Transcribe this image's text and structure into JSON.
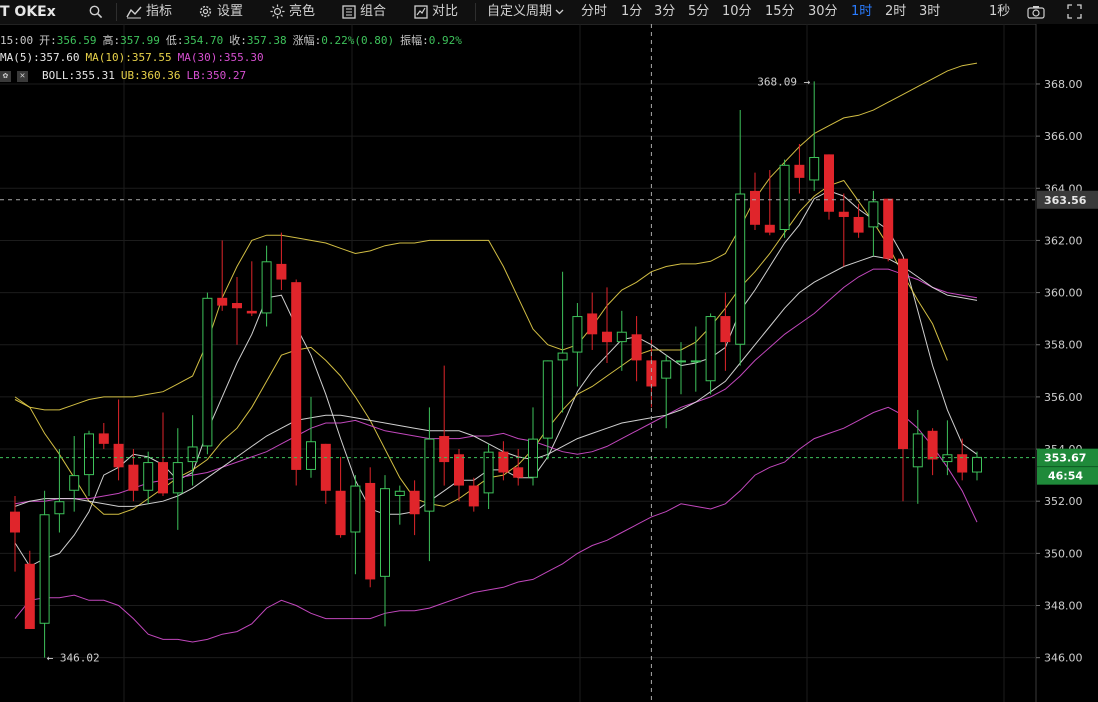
{
  "toolbar": {
    "title": "T OKEx",
    "indicators_label": "指标",
    "settings_label": "设置",
    "brightness_label": "亮色",
    "combine_label": "组合",
    "compare_label": "对比",
    "custom_period_label": "自定义周期",
    "periods": [
      "分时",
      "1分",
      "3分",
      "5分",
      "10分",
      "15分",
      "30分",
      "1时",
      "2时",
      "3时"
    ],
    "active_period": "1时",
    "refresh_label": "1秒"
  },
  "info": {
    "time": "15:00",
    "open_label": "开:",
    "open": "356.59",
    "high_label": "高:",
    "high": "357.99",
    "low_label": "低:",
    "low": "354.70",
    "close_label": "收:",
    "close": "357.38",
    "change_label": "涨幅:",
    "change": "0.22%(0.80)",
    "amp_label": "振幅:",
    "amp": "0.92%",
    "ma5": "MA(5):357.60",
    "ma10": "MA(10):357.55",
    "ma30": "MA(30):355.30",
    "boll": "BOLL:355.31",
    "ub": "UB:360.36",
    "lb": "LB:350.27"
  },
  "price_labels": {
    "crosshair": "363.56",
    "current": "353.67",
    "countdown": "46:54"
  },
  "annotations": {
    "high": "368.09 →",
    "low": "← 346.02"
  },
  "colors": {
    "up": "#3ec25b",
    "down": "#e0252b",
    "ma5": "#e6e6e6",
    "ma10": "#e8d24a",
    "ma30": "#d64fd0",
    "boll": "#e6e6e6",
    "ub": "#e8d24a",
    "lb": "#d64fd0"
  },
  "chart_data": {
    "type": "candlestick",
    "ylim": [
      344.3,
      370.3
    ],
    "y_ticks": [
      "346.00",
      "348.00",
      "350.00",
      "352.00",
      "354.00",
      "356.00",
      "358.00",
      "360.00",
      "362.00",
      "364.00",
      "366.00",
      "368.00"
    ],
    "candles": [
      {
        "o": 351.6,
        "h": 352.2,
        "l": 349.3,
        "c": 350.8
      },
      {
        "o": 349.6,
        "h": 350.1,
        "l": 347.1,
        "c": 347.1
      },
      {
        "o": 347.3,
        "h": 352.4,
        "l": 346.0,
        "c": 351.5
      },
      {
        "o": 351.5,
        "h": 354.0,
        "l": 350.8,
        "c": 352.0
      },
      {
        "o": 352.4,
        "h": 354.5,
        "l": 351.6,
        "c": 353.0
      },
      {
        "o": 353.0,
        "h": 354.7,
        "l": 352.2,
        "c": 354.6
      },
      {
        "o": 354.6,
        "h": 355.0,
        "l": 354.0,
        "c": 354.2
      },
      {
        "o": 354.2,
        "h": 355.9,
        "l": 352.8,
        "c": 353.3
      },
      {
        "o": 353.4,
        "h": 354.0,
        "l": 352.0,
        "c": 352.4
      },
      {
        "o": 352.4,
        "h": 353.9,
        "l": 351.9,
        "c": 353.5
      },
      {
        "o": 353.5,
        "h": 355.4,
        "l": 352.2,
        "c": 352.3
      },
      {
        "o": 352.3,
        "h": 354.8,
        "l": 350.9,
        "c": 353.5
      },
      {
        "o": 353.5,
        "h": 355.3,
        "l": 352.6,
        "c": 354.1
      },
      {
        "o": 354.1,
        "h": 360.0,
        "l": 353.8,
        "c": 359.8
      },
      {
        "o": 359.8,
        "h": 362.0,
        "l": 359.3,
        "c": 359.5
      },
      {
        "o": 359.6,
        "h": 360.6,
        "l": 358.0,
        "c": 359.4
      },
      {
        "o": 359.3,
        "h": 361.2,
        "l": 359.1,
        "c": 359.2
      },
      {
        "o": 359.2,
        "h": 361.8,
        "l": 358.7,
        "c": 361.2
      },
      {
        "o": 361.1,
        "h": 362.3,
        "l": 360.1,
        "c": 360.5
      },
      {
        "o": 360.4,
        "h": 360.5,
        "l": 352.6,
        "c": 353.2
      },
      {
        "o": 353.2,
        "h": 356.0,
        "l": 352.9,
        "c": 354.3
      },
      {
        "o": 354.2,
        "h": 354.2,
        "l": 351.9,
        "c": 352.4
      },
      {
        "o": 352.4,
        "h": 353.7,
        "l": 350.6,
        "c": 350.7
      },
      {
        "o": 350.8,
        "h": 353.0,
        "l": 349.2,
        "c": 352.6
      },
      {
        "o": 352.7,
        "h": 353.3,
        "l": 348.7,
        "c": 349.0
      },
      {
        "o": 349.1,
        "h": 353.0,
        "l": 347.2,
        "c": 352.5
      },
      {
        "o": 352.2,
        "h": 352.6,
        "l": 351.1,
        "c": 352.4
      },
      {
        "o": 352.4,
        "h": 352.8,
        "l": 350.7,
        "c": 351.5
      },
      {
        "o": 351.6,
        "h": 355.6,
        "l": 349.7,
        "c": 354.4
      },
      {
        "o": 354.5,
        "h": 357.2,
        "l": 352.6,
        "c": 353.5
      },
      {
        "o": 353.8,
        "h": 354.0,
        "l": 352.0,
        "c": 352.6
      },
      {
        "o": 352.6,
        "h": 352.9,
        "l": 351.6,
        "c": 351.8
      },
      {
        "o": 352.3,
        "h": 354.2,
        "l": 351.7,
        "c": 353.9
      },
      {
        "o": 353.9,
        "h": 354.3,
        "l": 352.8,
        "c": 353.1
      },
      {
        "o": 353.3,
        "h": 354.0,
        "l": 352.6,
        "c": 352.9
      },
      {
        "o": 352.9,
        "h": 355.6,
        "l": 352.6,
        "c": 354.4
      },
      {
        "o": 354.4,
        "h": 357.4,
        "l": 353.6,
        "c": 357.4
      },
      {
        "o": 357.4,
        "h": 360.8,
        "l": 355.4,
        "c": 357.7
      },
      {
        "o": 357.7,
        "h": 359.6,
        "l": 356.4,
        "c": 359.1
      },
      {
        "o": 359.2,
        "h": 360.0,
        "l": 357.8,
        "c": 358.4
      },
      {
        "o": 358.5,
        "h": 360.2,
        "l": 357.3,
        "c": 358.1
      },
      {
        "o": 358.1,
        "h": 359.3,
        "l": 357.0,
        "c": 358.5
      },
      {
        "o": 358.4,
        "h": 359.1,
        "l": 356.6,
        "c": 357.4
      },
      {
        "o": 357.4,
        "h": 358.2,
        "l": 355.6,
        "c": 356.4
      },
      {
        "o": 356.7,
        "h": 357.6,
        "l": 354.8,
        "c": 357.4
      },
      {
        "o": 357.4,
        "h": 358.1,
        "l": 356.1,
        "c": 357.4
      },
      {
        "o": 357.4,
        "h": 358.7,
        "l": 356.2,
        "c": 357.4
      },
      {
        "o": 356.6,
        "h": 359.2,
        "l": 356.1,
        "c": 359.1
      },
      {
        "o": 359.1,
        "h": 360.0,
        "l": 357.0,
        "c": 358.1
      },
      {
        "o": 358.0,
        "h": 367.0,
        "l": 357.2,
        "c": 363.8
      },
      {
        "o": 363.9,
        "h": 364.6,
        "l": 362.4,
        "c": 362.6
      },
      {
        "o": 362.6,
        "h": 364.7,
        "l": 362.2,
        "c": 362.3
      },
      {
        "o": 362.4,
        "h": 365.1,
        "l": 362.1,
        "c": 364.9
      },
      {
        "o": 364.9,
        "h": 365.7,
        "l": 363.8,
        "c": 364.4
      },
      {
        "o": 364.3,
        "h": 368.1,
        "l": 363.9,
        "c": 365.2
      },
      {
        "o": 365.3,
        "h": 365.3,
        "l": 362.8,
        "c": 363.1
      },
      {
        "o": 363.1,
        "h": 363.8,
        "l": 361.0,
        "c": 362.9
      },
      {
        "o": 362.9,
        "h": 363.4,
        "l": 362.1,
        "c": 362.3
      },
      {
        "o": 362.5,
        "h": 363.9,
        "l": 361.4,
        "c": 363.5
      },
      {
        "o": 363.6,
        "h": 363.6,
        "l": 361.2,
        "c": 361.3
      },
      {
        "o": 361.3,
        "h": 361.3,
        "l": 352.0,
        "c": 354.0
      },
      {
        "o": 353.3,
        "h": 355.5,
        "l": 351.9,
        "c": 354.6
      },
      {
        "o": 354.7,
        "h": 354.8,
        "l": 353.0,
        "c": 353.6
      },
      {
        "o": 353.5,
        "h": 355.1,
        "l": 353.0,
        "c": 353.8
      },
      {
        "o": 353.8,
        "h": 354.4,
        "l": 352.8,
        "c": 353.1
      },
      {
        "o": 353.1,
        "h": 353.9,
        "l": 352.8,
        "c": 353.7
      }
    ],
    "series": [
      {
        "name": "MA(5)",
        "values": [
          350.4,
          349.5,
          349.8,
          350.0,
          350.7,
          351.6,
          353.0,
          353.3,
          353.8,
          353.7,
          353.4,
          352.8,
          353.1,
          354.7,
          356.0,
          357.3,
          358.4,
          359.8,
          359.9,
          358.7,
          357.6,
          356.1,
          354.4,
          352.8,
          351.7,
          351.5,
          351.5,
          351.6,
          352.0,
          352.4,
          352.8,
          352.8,
          353.2,
          353.2,
          352.9,
          352.9,
          353.7,
          354.9,
          356.2,
          357.0,
          357.6,
          358.2,
          358.3,
          358.0,
          357.6,
          357.2,
          357.3,
          357.5,
          357.9,
          359.3,
          360.1,
          361.0,
          361.9,
          362.6,
          363.6,
          363.9,
          363.7,
          363.2,
          362.8,
          362.4,
          361.4,
          359.3,
          357.2,
          355.5,
          354.2,
          353.8
        ]
      },
      {
        "name": "MA(10)",
        "values": [
          356.0,
          355.6,
          354.6,
          353.8,
          352.9,
          352.0,
          351.5,
          351.5,
          351.7,
          352.1,
          352.5,
          352.9,
          353.2,
          353.6,
          354.3,
          354.8,
          355.6,
          356.6,
          357.6,
          357.8,
          357.9,
          357.4,
          356.8,
          356.0,
          355.1,
          354.0,
          352.9,
          352.1,
          351.9,
          351.8,
          352.1,
          352.5,
          352.9,
          353.0,
          353.4,
          354.0,
          354.8,
          355.5,
          356.1,
          356.4,
          356.8,
          357.2,
          357.6,
          357.8,
          357.8,
          357.8,
          358.1,
          358.7,
          359.4,
          360.2,
          360.8,
          361.5,
          362.3,
          363.1,
          363.7,
          364.1,
          364.3,
          363.5,
          362.7,
          361.8,
          360.7,
          359.7,
          358.8,
          357.4
        ]
      },
      {
        "name": "MA(30)",
        "values": [
          351.9,
          352.0,
          352.0,
          352.1,
          352.1,
          352.1,
          352.2,
          352.3,
          352.5,
          352.7,
          352.8,
          352.9,
          353.0,
          353.1,
          353.3,
          353.5,
          353.7,
          353.9,
          354.2,
          354.5,
          354.8,
          355.0,
          355.0,
          355.1,
          354.9,
          354.7,
          354.6,
          354.5,
          354.4,
          354.4,
          354.4,
          354.5,
          354.5,
          354.6,
          354.4,
          354.3,
          354.1,
          353.9,
          353.8,
          353.9,
          354.1,
          354.4,
          354.7,
          355.0,
          355.3,
          355.6,
          355.8,
          356.0,
          356.3,
          356.8,
          357.4,
          357.9,
          358.4,
          358.8,
          359.2,
          359.7,
          360.2,
          360.6,
          360.9,
          360.9,
          360.7,
          360.5,
          360.2,
          360.0,
          359.9,
          359.8
        ]
      },
      {
        "name": "BOLL",
        "values": [
          351.8,
          352.0,
          352.1,
          352.1,
          352.1,
          352.0,
          351.9,
          351.8,
          351.8,
          351.9,
          352.0,
          352.2,
          352.5,
          352.9,
          353.3,
          353.7,
          354.1,
          354.5,
          354.8,
          355.1,
          355.2,
          355.3,
          355.3,
          355.2,
          355.1,
          355.0,
          354.9,
          354.8,
          354.7,
          354.7,
          354.7,
          354.5,
          354.2,
          353.9,
          353.7,
          353.6,
          353.8,
          354.1,
          354.4,
          354.6,
          354.8,
          355.0,
          355.1,
          355.2,
          355.3,
          355.5,
          355.8,
          356.2,
          356.6,
          357.3,
          358.0,
          358.7,
          359.4,
          360.0,
          360.4,
          360.7,
          361.0,
          361.2,
          361.4,
          361.3,
          361.0,
          360.6,
          360.2,
          359.9,
          359.8,
          359.7
        ]
      },
      {
        "name": "UB",
        "values": [
          355.9,
          355.6,
          355.5,
          355.5,
          355.7,
          355.9,
          356.0,
          356.0,
          356.0,
          356.1,
          356.2,
          356.5,
          356.8,
          358.1,
          359.8,
          361.0,
          362.0,
          362.2,
          362.2,
          362.1,
          362.0,
          361.9,
          361.7,
          361.5,
          361.6,
          361.8,
          361.9,
          361.9,
          362.0,
          362.0,
          362.0,
          362.0,
          362.0,
          361.0,
          359.8,
          358.6,
          358.0,
          357.8,
          358.0,
          358.7,
          359.5,
          360.1,
          360.4,
          360.8,
          361.0,
          361.1,
          361.1,
          361.2,
          361.5,
          362.5,
          363.6,
          364.4,
          365.0,
          365.6,
          366.1,
          366.4,
          366.7,
          366.8,
          367.0,
          367.3,
          367.6,
          367.9,
          368.2,
          368.5,
          368.7,
          368.8
        ]
      },
      {
        "name": "LB",
        "values": [
          347.5,
          348.2,
          348.3,
          348.3,
          348.4,
          348.2,
          348.2,
          348.0,
          347.5,
          346.9,
          346.7,
          346.7,
          346.6,
          346.7,
          346.9,
          347.0,
          347.3,
          347.9,
          348.2,
          348.0,
          347.7,
          347.5,
          347.5,
          347.5,
          347.5,
          347.7,
          347.8,
          347.8,
          347.9,
          348.1,
          348.3,
          348.5,
          348.6,
          348.7,
          348.9,
          349.0,
          349.3,
          349.6,
          350.0,
          350.3,
          350.5,
          350.8,
          351.1,
          351.4,
          351.6,
          351.9,
          351.8,
          351.7,
          351.9,
          352.4,
          353.0,
          353.3,
          353.5,
          354.0,
          354.4,
          354.6,
          354.8,
          355.1,
          355.4,
          355.6,
          355.3,
          354.8,
          354.1,
          353.3,
          352.4,
          351.2
        ]
      }
    ]
  }
}
